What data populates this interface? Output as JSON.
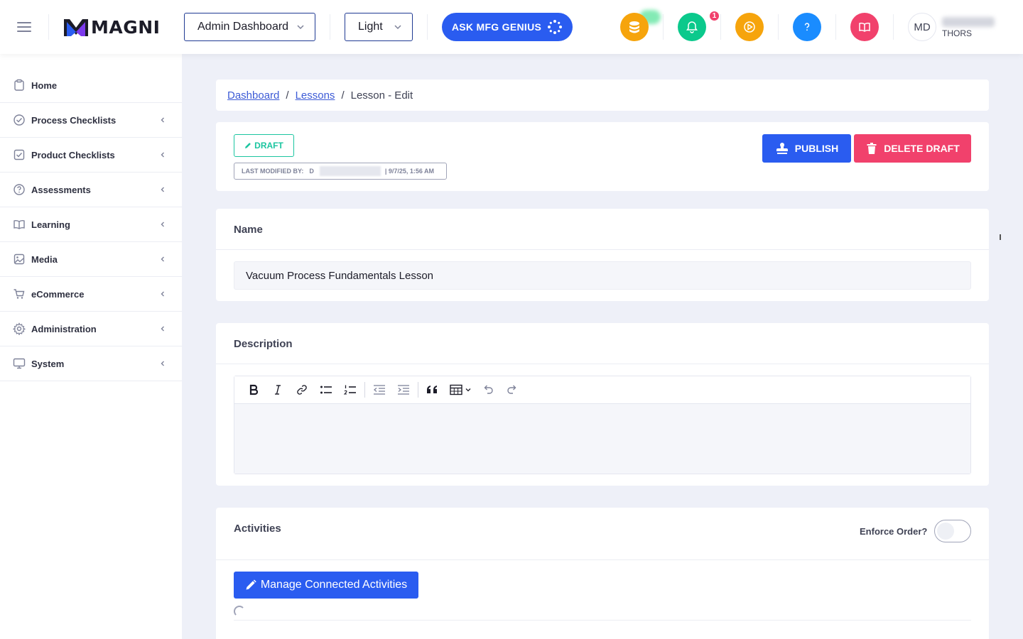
{
  "header": {
    "logo_text": "MAGNI",
    "dashboard_select": "Admin Dashboard",
    "theme_select": "Light",
    "genius_label": "ASK MFG GENIUS",
    "notification_count": "1",
    "avatar_initials": "MD",
    "user_org": "THORS",
    "icon_colors": {
      "coins": "#f6a40c",
      "bell": "#0bc98c",
      "play": "#f6a40c",
      "help": "#1a8cff",
      "book": "#f1416c"
    }
  },
  "sidebar": {
    "items": [
      {
        "label": "Home",
        "icon": "clipboard-icon"
      },
      {
        "label": "Process Checklists",
        "icon": "check-circle-icon"
      },
      {
        "label": "Product Checklists",
        "icon": "check-square-icon"
      },
      {
        "label": "Assessments",
        "icon": "question-circle-icon"
      },
      {
        "label": "Learning",
        "icon": "book-open-icon"
      },
      {
        "label": "Media",
        "icon": "image-icon"
      },
      {
        "label": "eCommerce",
        "icon": "cart-icon"
      },
      {
        "label": "Administration",
        "icon": "gear-icon"
      },
      {
        "label": "System",
        "icon": "monitor-icon"
      }
    ]
  },
  "breadcrumb": {
    "items": [
      "Dashboard",
      "Lessons"
    ],
    "separator": "/",
    "current": "Lesson - Edit"
  },
  "status": {
    "badge": "DRAFT",
    "modified_label": "LAST MODIFIED BY:",
    "modified_user_initial": "D",
    "modified_date": "| 9/7/25, 1:56 AM",
    "publish_label": "PUBLISH",
    "delete_label": "DELETE DRAFT"
  },
  "name_section": {
    "title": "Name",
    "value": "Vacuum Process Fundamentals Lesson"
  },
  "description_section": {
    "title": "Description",
    "toolbar": [
      "bold-icon",
      "italic-icon",
      "link-icon",
      "bullet-list-icon",
      "numbered-list-icon",
      "outdent-icon",
      "indent-icon",
      "quote-icon",
      "table-icon",
      "undo-icon",
      "redo-icon"
    ],
    "value": ""
  },
  "activities_section": {
    "title": "Activities",
    "enforce_label": "Enforce Order?",
    "enforce_on": false,
    "manage_label": "Manage Connected Activities"
  }
}
